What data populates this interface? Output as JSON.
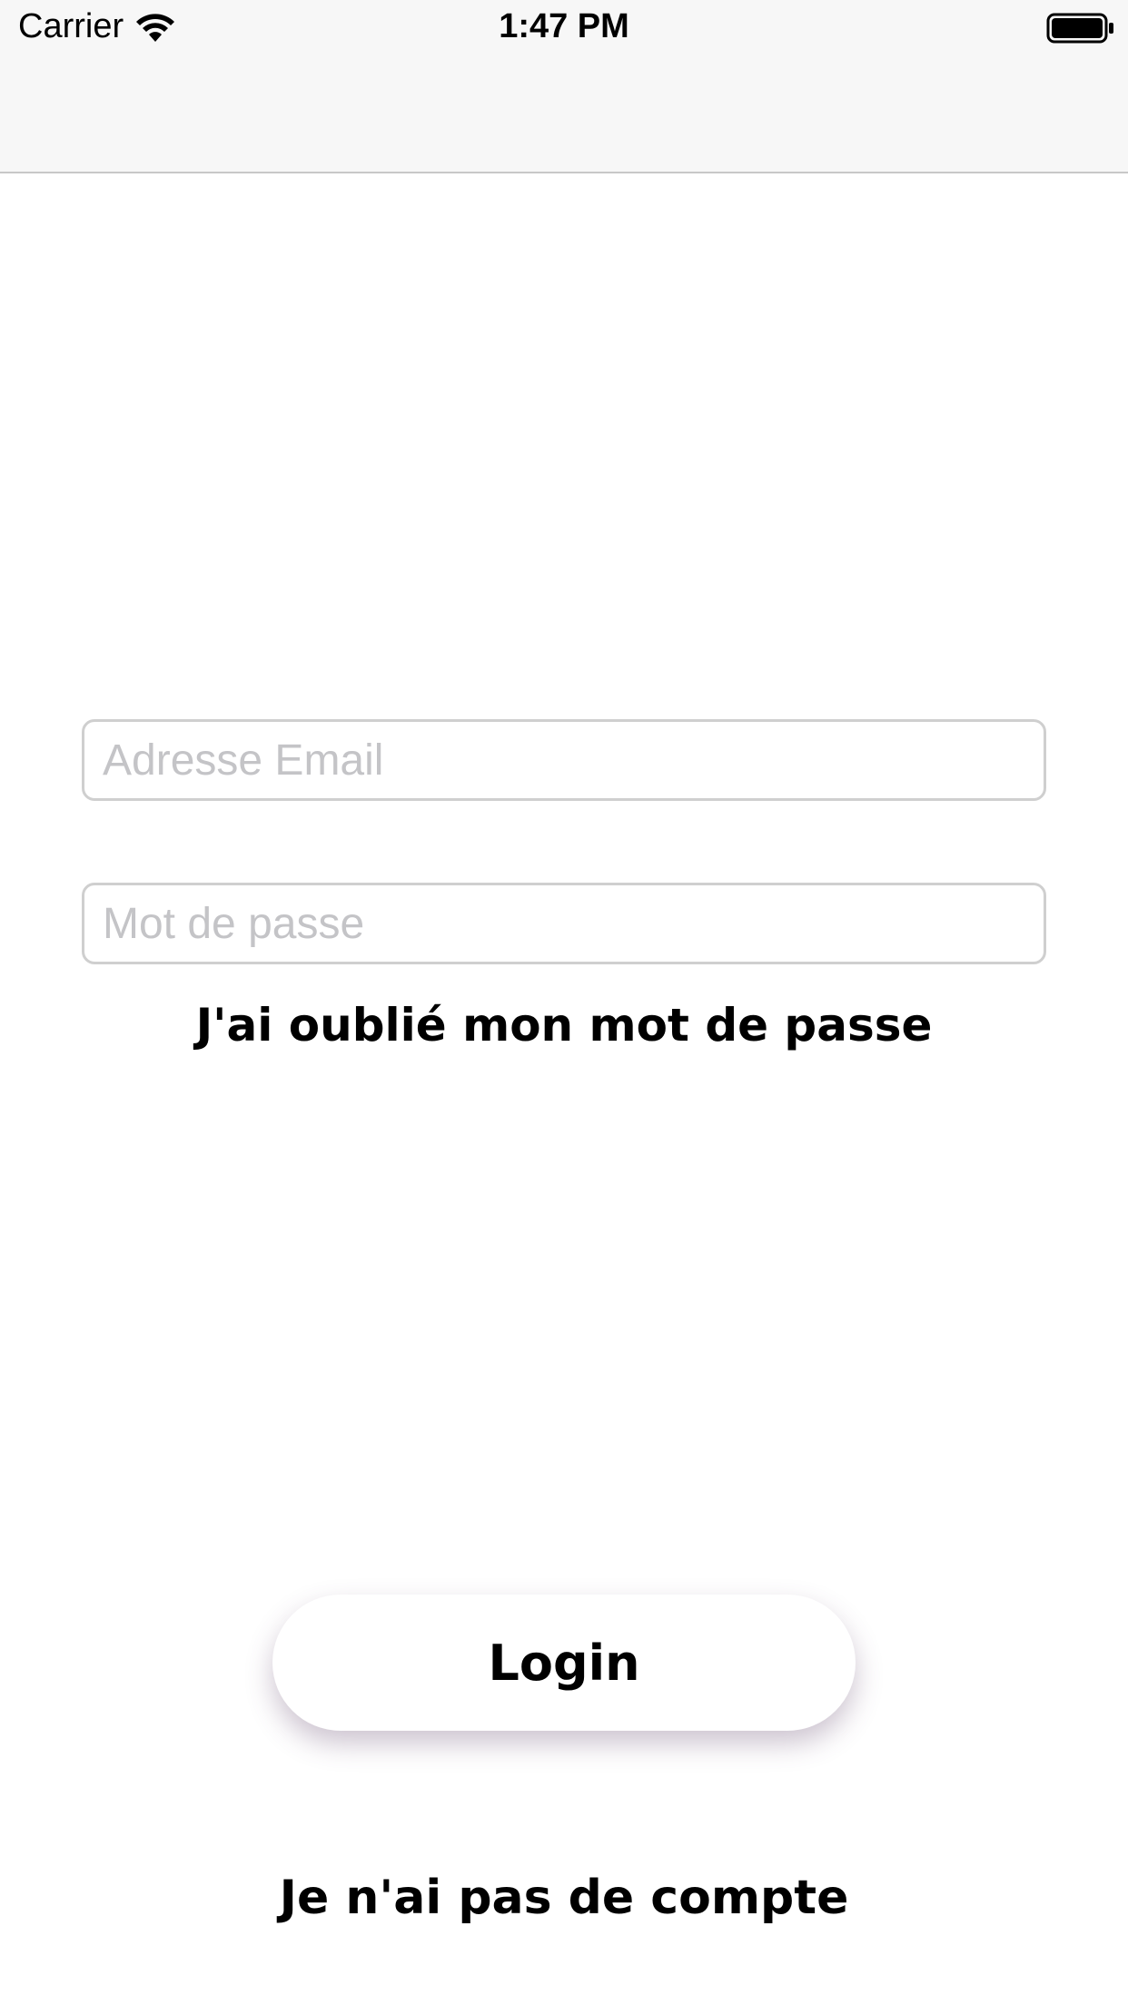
{
  "status_bar": {
    "carrier": "Carrier",
    "time": "1:47 PM",
    "wifi_icon": "wifi-icon",
    "battery_icon": "battery-icon"
  },
  "login_form": {
    "email_placeholder": "Adresse Email",
    "email_value": "",
    "password_placeholder": "Mot de passe",
    "password_value": "",
    "forgot_password_label": "J'ai oublié mon mot de passe",
    "login_label": "Login",
    "no_account_label": "Je n'ai pas de compte"
  },
  "colors": {
    "background": "#ffffff",
    "bar_background": "#f7f7f7",
    "placeholder": "#c4c4c7",
    "field_border": "#cfcfcf",
    "text": "#000000"
  }
}
